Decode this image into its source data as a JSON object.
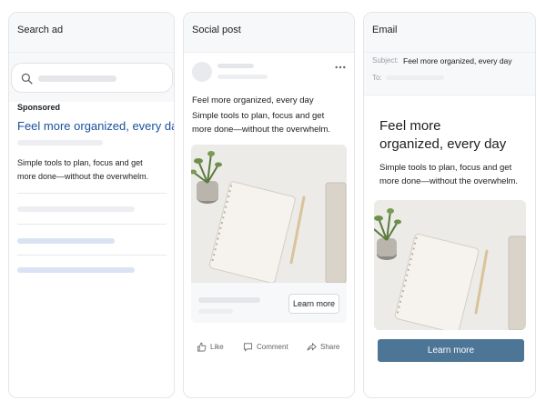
{
  "search_ad": {
    "title": "Search ad",
    "sponsored": "Sponsored",
    "headline": "Feel more organized, every day",
    "description_lines": [
      "Simple tools to plan, focus and get",
      "more done—without the overwhelm."
    ]
  },
  "social_post": {
    "title": "Social post",
    "text_lines": [
      "Feel more organized, every day",
      "Simple tools to plan, focus and get",
      "more done—without the overwhelm."
    ],
    "cta_label": "Learn more",
    "actions": {
      "like": "Like",
      "comment": "Comment",
      "share": "Share"
    }
  },
  "email": {
    "title": "Email",
    "subject_label": "Subject:",
    "subject_value": "Feel more organized, every day",
    "to_label": "To:",
    "headline_lines": [
      "Feel more",
      "organized, every day"
    ],
    "body_lines": [
      "Simple tools to plan, focus and get",
      "more done—without the overwhelm."
    ],
    "cta_label": "Learn more"
  },
  "colors": {
    "headline_blue": "#1a4f9c",
    "email_button": "#4d7596"
  }
}
